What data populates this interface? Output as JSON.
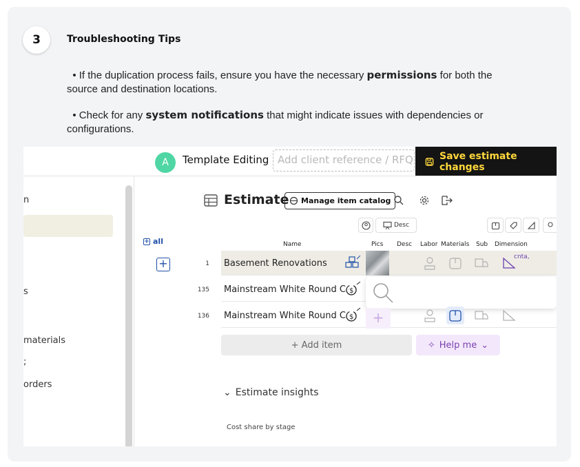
{
  "step": {
    "number": "3",
    "title": "Troubleshooting Tips"
  },
  "tips": [
    {
      "pre": "• If the duplication process fails, ensure you have the necessary ",
      "bold": "permissions",
      "post_line1": " for both the",
      "line2": "source and destination locations."
    },
    {
      "pre": "• Check for any ",
      "bold": "system notifications",
      "post_line1": " that might indicate issues with dependencies or",
      "line2": "configurations."
    }
  ],
  "screenshot": {
    "topbar": {
      "avatar_letter": "A",
      "title": "Template Editing",
      "client_ref_placeholder": "Add client reference / RFQ#",
      "save_label": "Save estimate changes"
    },
    "sidebar": {
      "items": [
        "n",
        "s",
        " materials",
        ";",
        "orders"
      ]
    },
    "estimate": {
      "title": "Estimate",
      "catalog_button": "Manage item catalog",
      "desc_toggle": "Desc",
      "all_label": "all",
      "headers": {
        "name": "Name",
        "pics": "Pics",
        "desc": "Desc",
        "labor": "Labor",
        "materials": "Materials",
        "sub": "Sub",
        "dimension": "Dimension"
      },
      "rows": [
        {
          "num": "1",
          "name": "Basement Renovations",
          "dim": "cnta,"
        },
        {
          "num": "135",
          "name": "Mainstream White Round C"
        },
        {
          "num": "136",
          "name": "Mainstream White Round C"
        }
      ],
      "add_item": "+ Add item",
      "help_me": "Help me",
      "insights": "Estimate insights",
      "cost_share": "Cost share by stage"
    }
  },
  "colors": {
    "card_bg": "#f3f4f6",
    "save_bg": "#141414",
    "save_text": "#ffd83b",
    "avatar": "#4fd6a4",
    "link_blue": "#1f4fa8",
    "help_bg": "#f3e8fb"
  }
}
